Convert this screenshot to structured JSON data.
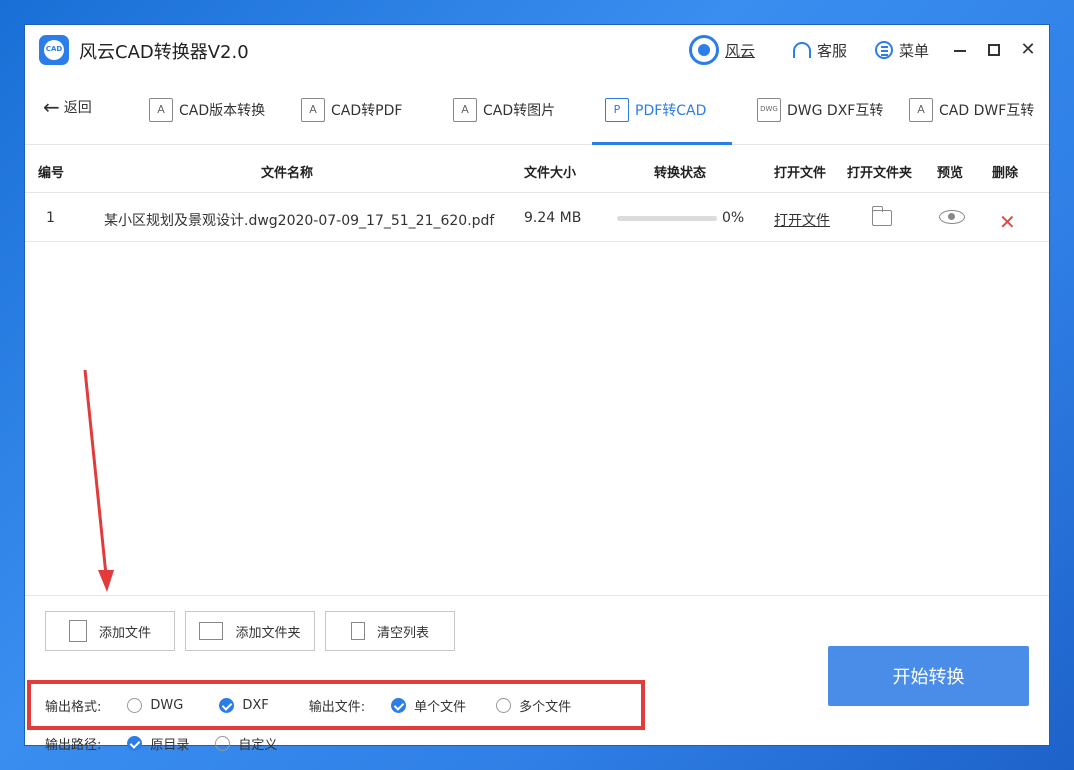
{
  "app": {
    "title": "风云CAD转换器V2.0",
    "logo_text": "CAD",
    "brand": "风云",
    "service": "客服",
    "menu": "菜单"
  },
  "nav": {
    "back": "返回",
    "tabs": [
      {
        "label": "CAD版本转换",
        "icon": "A"
      },
      {
        "label": "CAD转PDF",
        "icon": "A"
      },
      {
        "label": "CAD转图片",
        "icon": "A"
      },
      {
        "label": "PDF转CAD",
        "icon": "P",
        "active": true
      },
      {
        "label": "DWG DXF互转",
        "icon": "DWG"
      },
      {
        "label": "CAD DWF互转",
        "icon": "A"
      }
    ]
  },
  "table": {
    "headers": [
      "编号",
      "文件名称",
      "文件大小",
      "转换状态",
      "打开文件",
      "打开文件夹",
      "预览",
      "删除"
    ],
    "rows": [
      {
        "index": "1",
        "filename": "某小区规划及景观设计.dwg2020-07-09_17_51_21_620.pdf",
        "size": "9.24 MB",
        "progress": 0,
        "progress_text": "0%",
        "open_file": "打开文件"
      }
    ]
  },
  "actions": {
    "add_file": "添加文件",
    "add_folder": "添加文件夹",
    "clear_list": "清空列表",
    "start": "开始转换"
  },
  "options": {
    "format_label": "输出格式:",
    "format_dwg": "DWG",
    "format_dxf": "DXF",
    "format_selected": "DXF",
    "output_label": "输出文件:",
    "output_single": "单个文件",
    "output_multi": "多个文件",
    "output_selected": "单个文件",
    "path_label": "输出路径:",
    "path_original": "原目录",
    "path_custom": "自定义",
    "path_selected": "原目录"
  },
  "colors": {
    "accent": "#2b7de9",
    "highlight_box": "#e23b3b",
    "delete": "#e04848"
  }
}
